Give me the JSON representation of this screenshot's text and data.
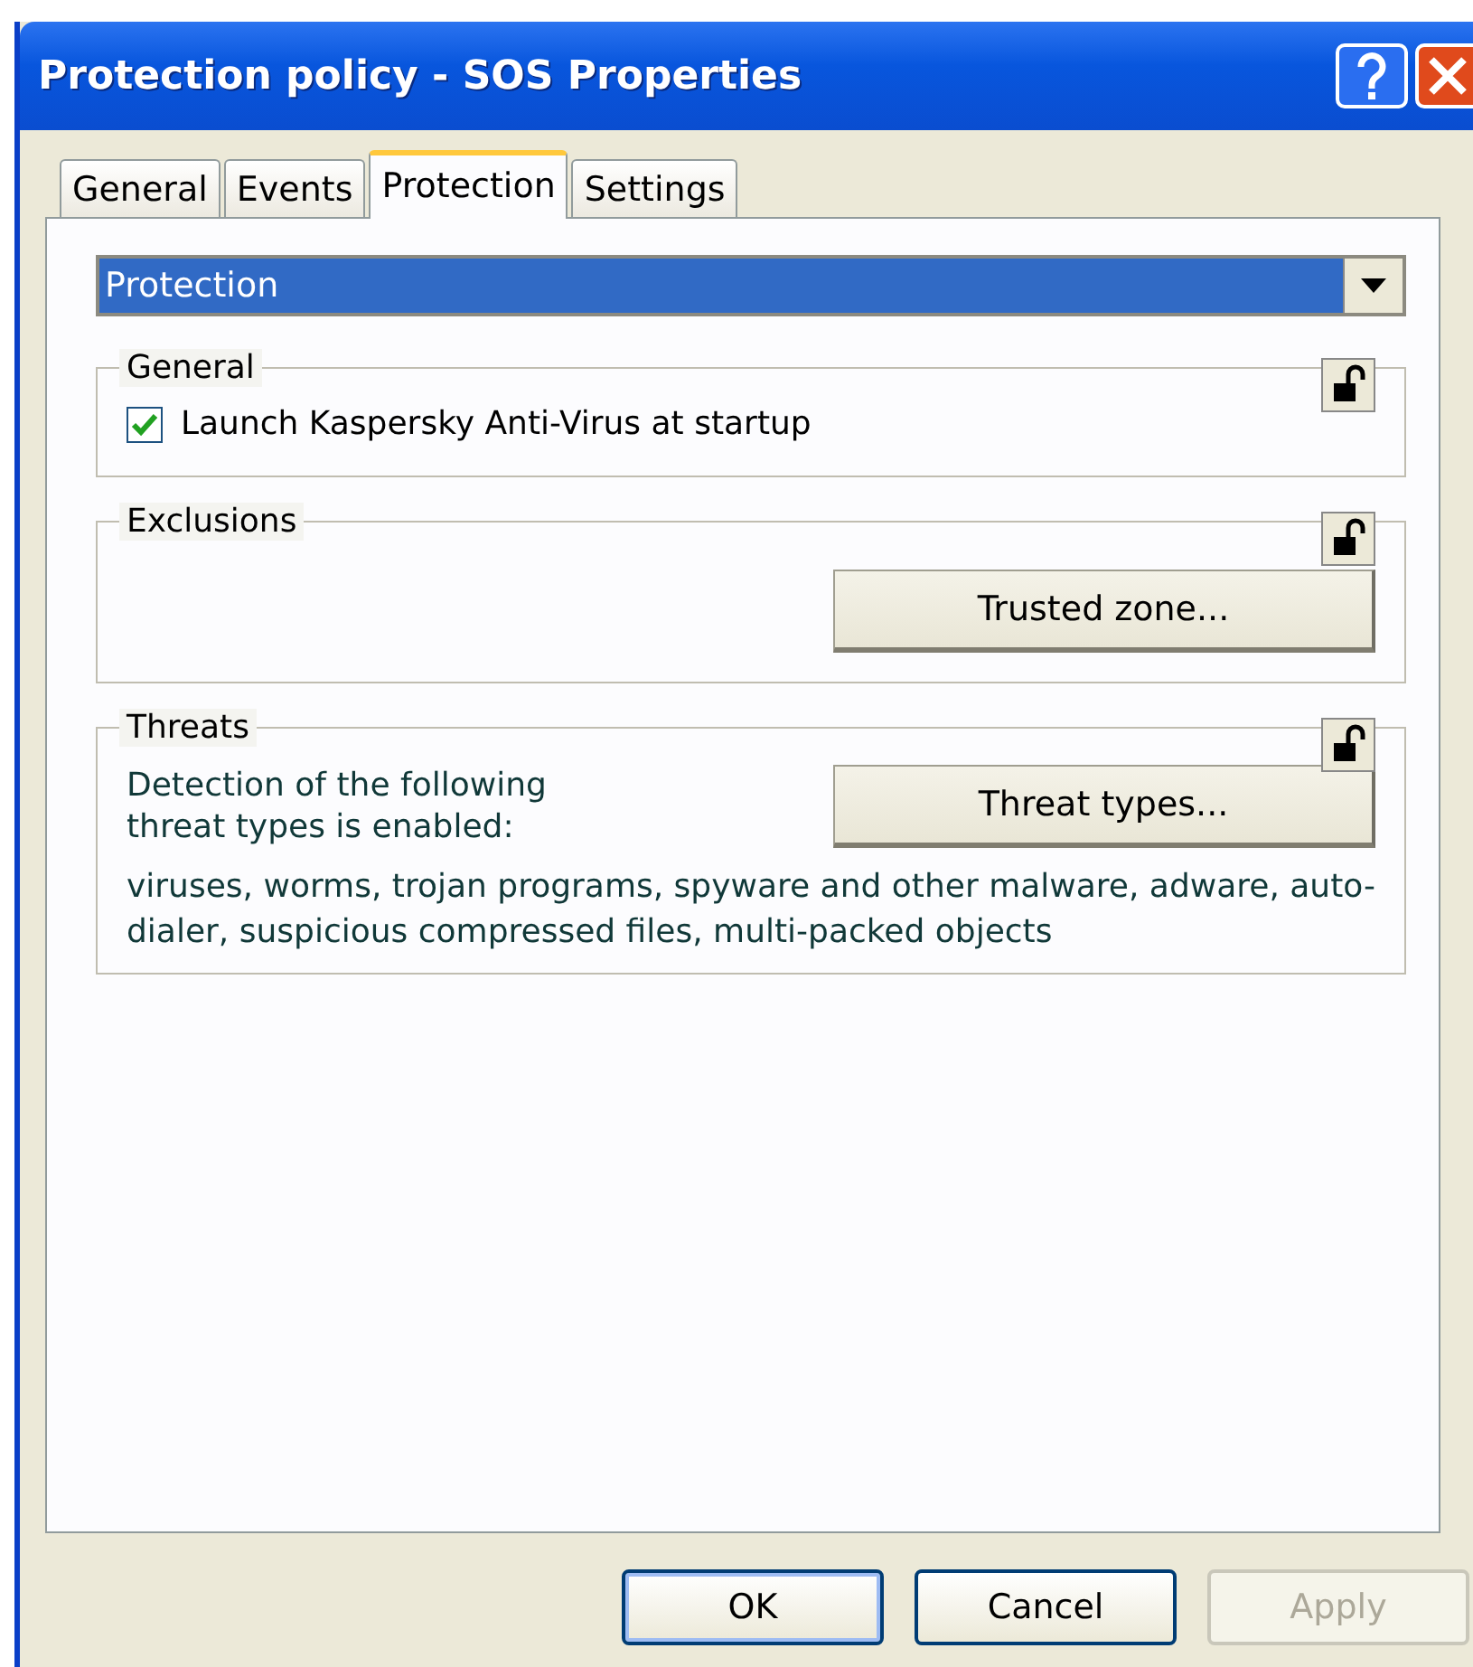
{
  "window": {
    "title": "Protection policy - SOS Properties"
  },
  "tabs": [
    {
      "label": "General",
      "selected": false
    },
    {
      "label": "Events",
      "selected": false
    },
    {
      "label": "Protection",
      "selected": true
    },
    {
      "label": "Settings",
      "selected": false
    }
  ],
  "dropdown": {
    "value": "Protection"
  },
  "groups": [
    {
      "title": "General",
      "locked": false,
      "kind": "checkbox",
      "label": "Launch Kaspersky Anti-Virus at startup",
      "checked": true
    },
    {
      "title": "Exclusions",
      "locked": false,
      "kind": "button",
      "button": "Trusted zone..."
    },
    {
      "title": "Threats",
      "locked": false,
      "kind": "threats",
      "text": "Detection of the following threat types is enabled:",
      "button": "Threat types...",
      "list": "viruses, worms, trojan programs, spyware and other malware, adware, auto-dialer, suspicious compressed files, multi-packed objects"
    }
  ],
  "buttons": [
    {
      "label": "OK",
      "default": true,
      "disabled": false
    },
    {
      "label": "Cancel",
      "default": false,
      "disabled": false
    },
    {
      "label": "Apply",
      "default": false,
      "disabled": true
    }
  ]
}
